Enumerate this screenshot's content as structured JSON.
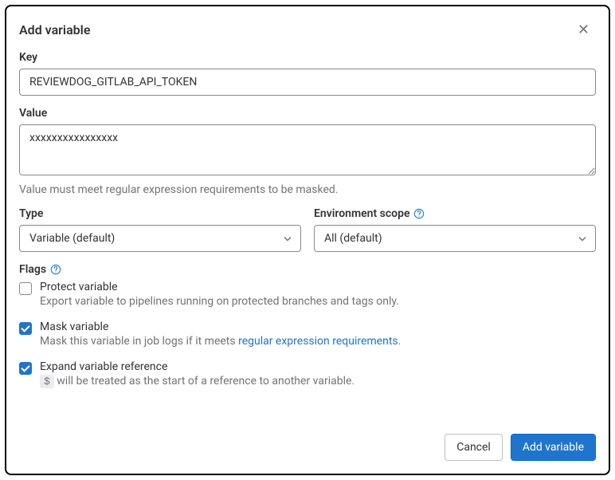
{
  "modal": {
    "title": "Add variable"
  },
  "key": {
    "label": "Key",
    "value": "REVIEWDOG_GITLAB_API_TOKEN"
  },
  "value": {
    "label": "Value",
    "content": "xxxxxxxxxxxxxxxx",
    "help": "Value must meet regular expression requirements to be masked."
  },
  "type": {
    "label": "Type",
    "selected": "Variable (default)"
  },
  "scope": {
    "label": "Environment scope",
    "selected": "All (default)"
  },
  "flags": {
    "label": "Flags",
    "protect": {
      "label": "Protect variable",
      "desc": "Export variable to pipelines running on protected branches and tags only.",
      "checked": false
    },
    "mask": {
      "label": "Mask variable",
      "desc_pre": "Mask this variable in job logs if it meets ",
      "desc_link": "regular expression requirements",
      "desc_post": ".",
      "checked": true
    },
    "expand": {
      "label": "Expand variable reference",
      "desc_code": "$",
      "desc_post": " will be treated as the start of a reference to another variable.",
      "checked": true
    }
  },
  "buttons": {
    "cancel": "Cancel",
    "submit": "Add variable"
  }
}
